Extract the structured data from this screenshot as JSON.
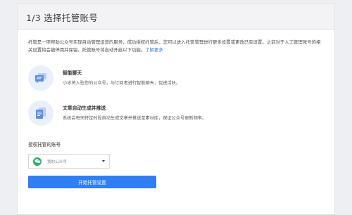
{
  "header": {
    "step_title": "1/3 选择托管账号"
  },
  "intro": {
    "text": "托管是一项帮助公众号实现自动管理运营的服务，成功授权托管后，您可以进入托管管理进行更多设置或更改已有设置。之前对于人工管理账号的相关设置将会被停用并保留。托管账号将自动开启以下功能。",
    "link": "了解更多"
  },
  "features": [
    {
      "icon": "chat-bubbles-icon",
      "title": "智能聊天",
      "desc": "小冰将入驻您的公众号，与订阅者进行智能聊天，促进活跃。"
    },
    {
      "icon": "documents-icon",
      "title": "文章自动生成并推送",
      "desc": "系统会每天特定时段自动生成文章并推送至素材库，保证公众号更新频率。"
    }
  ],
  "account": {
    "label": "授权托管的账号",
    "selected": "我的公众号",
    "icon": "wechat-icon"
  },
  "start_button": {
    "label": "开始托管设置"
  },
  "colors": {
    "accent": "#2f7ff2",
    "wechat": "#2aae67",
    "icon_bg": "#e9f0fb"
  }
}
